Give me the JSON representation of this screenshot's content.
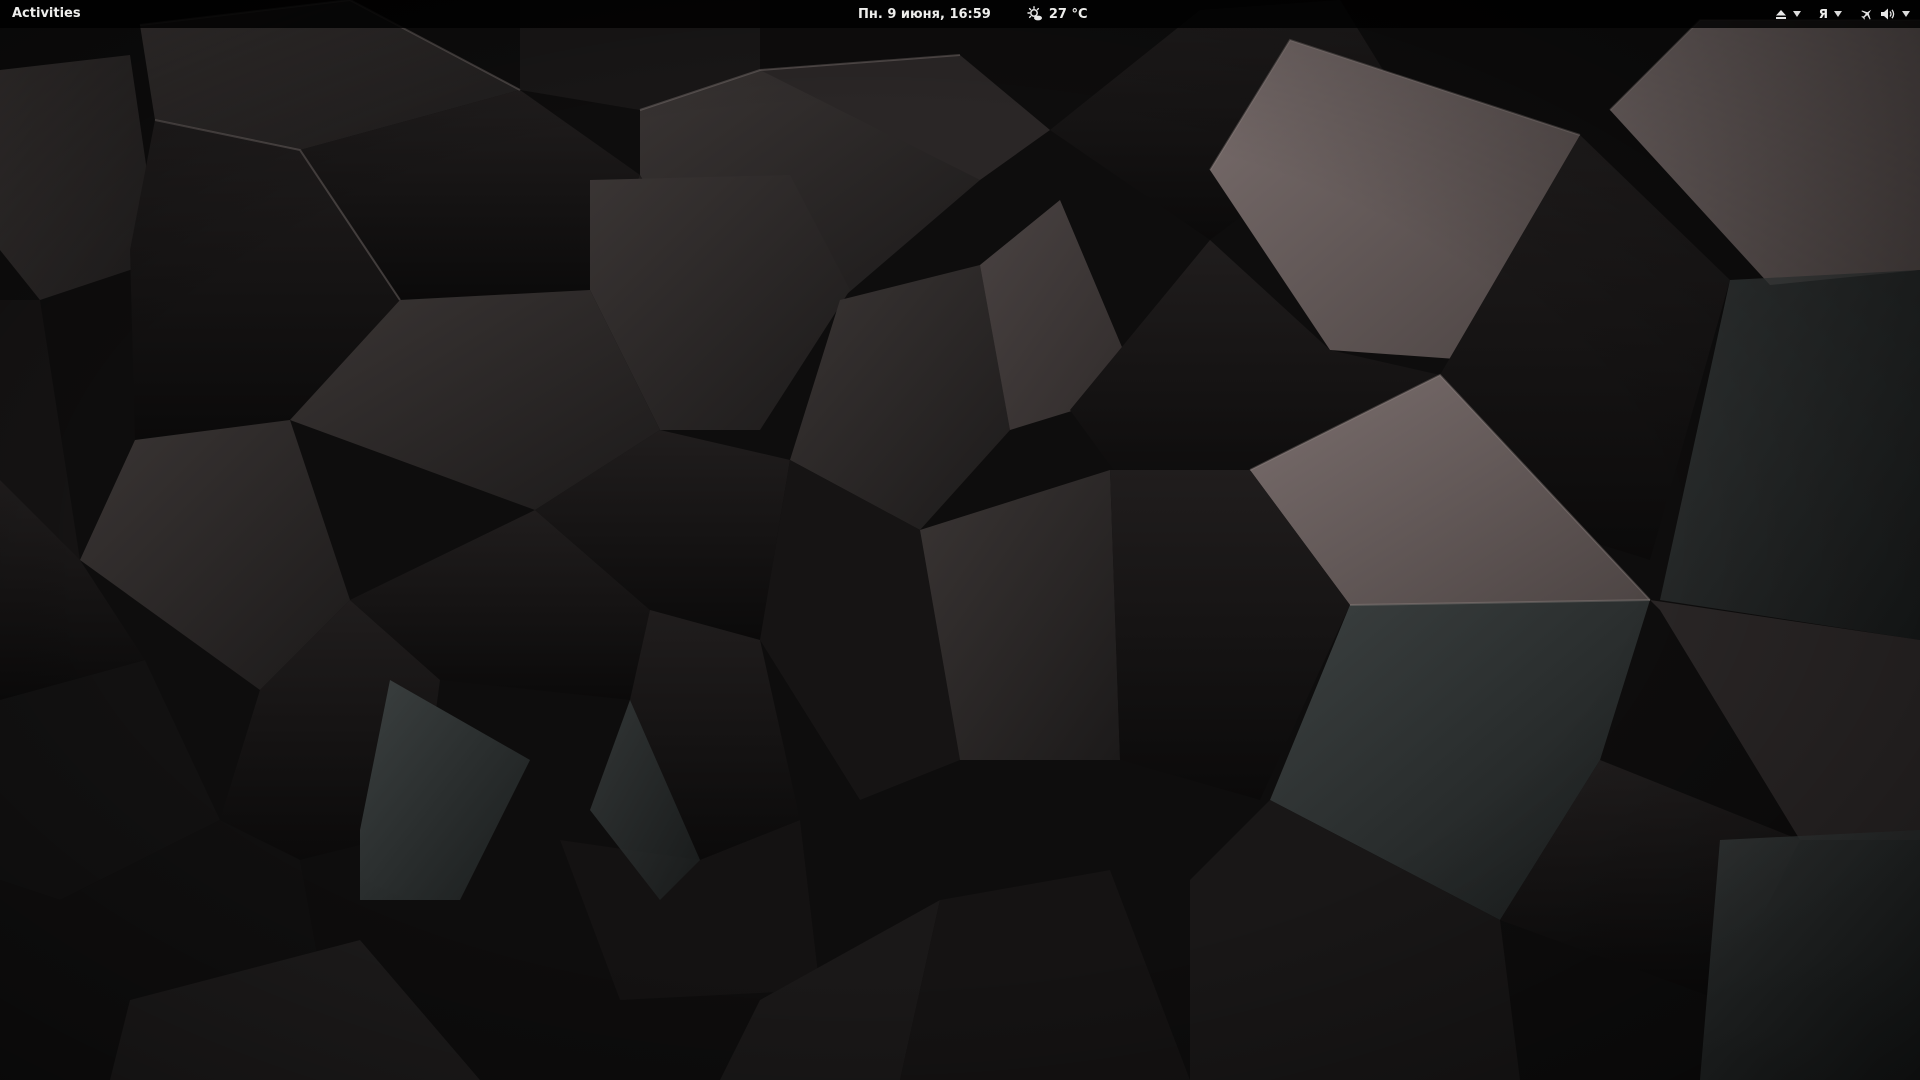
{
  "topbar": {
    "activities_label": "Activities",
    "clock": "Пн.  9 июня, 16:59",
    "weather": {
      "icon": "weather-sun-cloud-icon",
      "temperature": "27 °C"
    },
    "indicators": {
      "eject_icon": "eject-icon",
      "keyboard_layout": "Я",
      "airplane_icon": "airplane-mode-icon",
      "volume_icon": "volume-icon"
    }
  },
  "wallpaper": {
    "description_colors": [
      "#0c0b0b",
      "#2a2626",
      "#4a4242",
      "#6b605f",
      "#2f3332"
    ]
  }
}
